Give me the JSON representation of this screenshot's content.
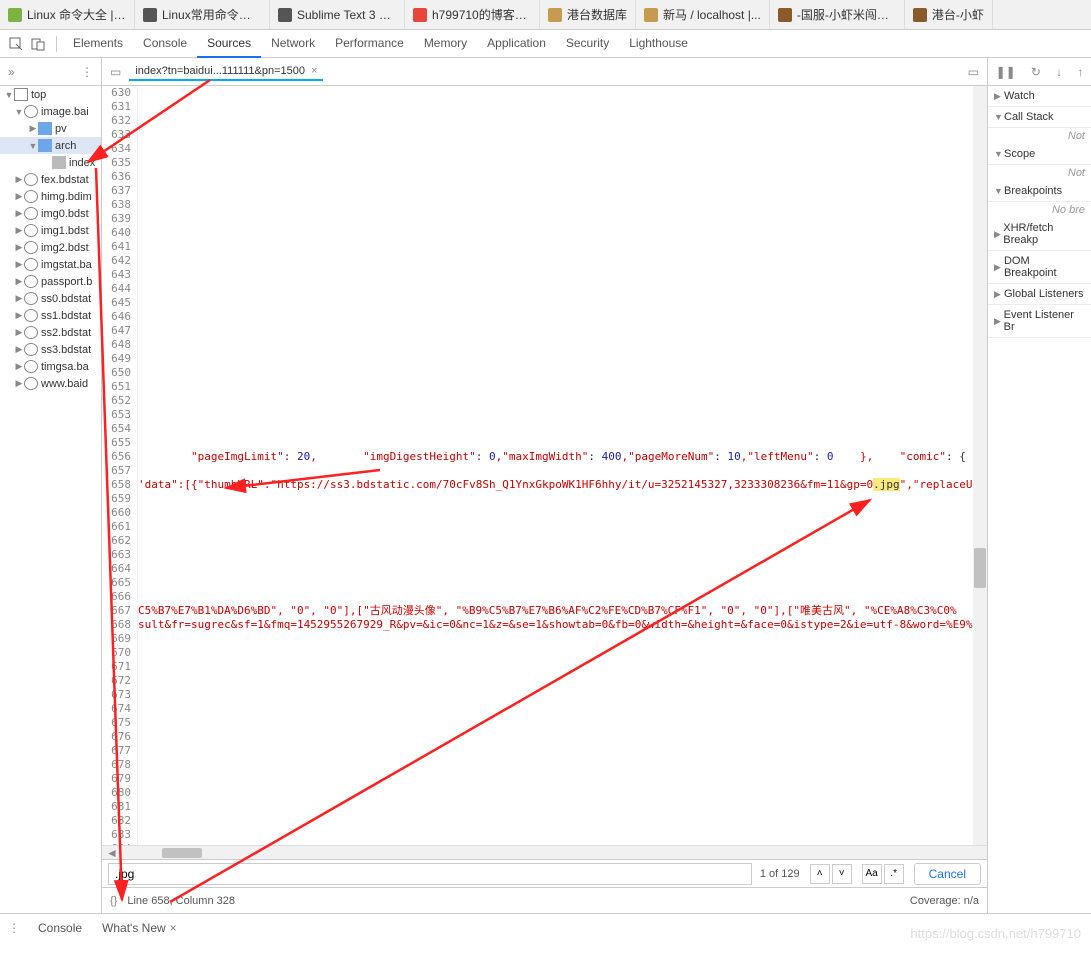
{
  "browserTabs": [
    {
      "label": "Linux 命令大全 | 菜...",
      "fav": "#7cb342"
    },
    {
      "label": "Linux常用命令大全...",
      "fav": "#555"
    },
    {
      "label": "Sublime Text 3 快...",
      "fav": "#555"
    },
    {
      "label": "h799710的博客_C...",
      "fav": "#e8453c"
    },
    {
      "label": "港台数据库",
      "fav": "#c69b4f"
    },
    {
      "label": "新马 / localhost |...",
      "fav": "#c69b4f"
    },
    {
      "label": "-国服-小虾米闯江湖",
      "fav": "#8a5a2a"
    },
    {
      "label": "港台-小虾",
      "fav": "#8a5a2a"
    }
  ],
  "devtoolsTabs": [
    "Elements",
    "Console",
    "Sources",
    "Network",
    "Performance",
    "Memory",
    "Application",
    "Security",
    "Lighthouse"
  ],
  "activeDevtoolsTab": "Sources",
  "openFileTab": "index?tn=baidui...111111&pn=1500",
  "tree": [
    {
      "ind": 1,
      "tw": "▼",
      "icon": "window",
      "label": "top"
    },
    {
      "ind": 2,
      "tw": "▼",
      "icon": "cloud",
      "label": "image.bai"
    },
    {
      "ind": 3,
      "tw": "▶",
      "icon": "folder",
      "label": "pv"
    },
    {
      "ind": 3,
      "tw": "▼",
      "icon": "folder",
      "label": "arch",
      "selected": true
    },
    {
      "ind": 4,
      "tw": "",
      "icon": "file",
      "label": "index"
    },
    {
      "ind": 2,
      "tw": "▶",
      "icon": "cloud",
      "label": "fex.bdstat"
    },
    {
      "ind": 2,
      "tw": "▶",
      "icon": "cloud",
      "label": "himg.bdim"
    },
    {
      "ind": 2,
      "tw": "▶",
      "icon": "cloud",
      "label": "img0.bdst"
    },
    {
      "ind": 2,
      "tw": "▶",
      "icon": "cloud",
      "label": "img1.bdst"
    },
    {
      "ind": 2,
      "tw": "▶",
      "icon": "cloud",
      "label": "img2.bdst"
    },
    {
      "ind": 2,
      "tw": "▶",
      "icon": "cloud",
      "label": "imgstat.ba"
    },
    {
      "ind": 2,
      "tw": "▶",
      "icon": "cloud",
      "label": "passport.b"
    },
    {
      "ind": 2,
      "tw": "▶",
      "icon": "cloud",
      "label": "ss0.bdstat"
    },
    {
      "ind": 2,
      "tw": "▶",
      "icon": "cloud",
      "label": "ss1.bdstat"
    },
    {
      "ind": 2,
      "tw": "▶",
      "icon": "cloud",
      "label": "ss2.bdstat"
    },
    {
      "ind": 2,
      "tw": "▶",
      "icon": "cloud",
      "label": "ss3.bdstat"
    },
    {
      "ind": 2,
      "tw": "▶",
      "icon": "cloud",
      "label": "timgsa.ba"
    },
    {
      "ind": 2,
      "tw": "▶",
      "icon": "cloud",
      "label": "www.baid"
    }
  ],
  "lineStart": 630,
  "lineEnd": 685,
  "code656": {
    "a": "        \"pageImgLimit\"",
    "b": ": ",
    "c": "20",
    "d": ",       \"imgDigestHeight\"",
    "e": ": ",
    "f": "0",
    "g": ",\"maxImgWidth\"",
    "h": ": ",
    "i": "400",
    "j": ",\"pageMoreNum\"",
    "k": ": ",
    "l": "10",
    "m": ",\"leftMenu\"",
    "n": ": ",
    "o": "0",
    "p": "    },    \"comic\"",
    "q": ": {"
  },
  "code658": {
    "a": "'data\":[{\"thumbURL\":\"https://ss3.bdstatic.com/70cFv8Sh_Q1YnxGkpoWK1HF6hhy/it/u=3252145327,3233308236&fm=11&gp=0",
    "hl": ".jpg",
    "b": "\",\"replaceU"
  },
  "code667": "C5%B7%E7%B1%DA%D6%BD\", \"0\", \"0\"],[\"古风动漫头像\", \"%B9%C5%B7%E7%B6%AF%C2%FE%CD%B7%CF%F1\", \"0\", \"0\"],[\"唯美古风\", \"%CE%A8%C3%C0%",
  "code668": "sult&fr=sugrec&sf=1&fmq=1452955267929_R&pv=&ic=0&nc=1&z=&se=1&showtab=0&fb=0&width=&height=&face=0&istype=2&ie=utf-8&word=%E9%",
  "search": {
    "value": ".jpg",
    "count": "1 of 129",
    "cancel": "Cancel"
  },
  "status": {
    "pos": "Line 658, Column 328",
    "coverage": "Coverage: n/a"
  },
  "rightPanel": {
    "sections": [
      {
        "tw": "▶",
        "label": "Watch"
      },
      {
        "tw": "▼",
        "label": "Call Stack"
      },
      {
        "italic": "Not"
      },
      {
        "tw": "▼",
        "label": "Scope"
      },
      {
        "italic": "Not"
      },
      {
        "tw": "▼",
        "label": "Breakpoints"
      },
      {
        "italic": "No bre"
      },
      {
        "tw": "▶",
        "label": "XHR/fetch Breakp"
      },
      {
        "tw": "▶",
        "label": "DOM Breakpoint"
      },
      {
        "tw": "▶",
        "label": "Global Listeners"
      },
      {
        "tw": "▶",
        "label": "Event Listener Br"
      }
    ]
  },
  "drawer": {
    "tab1": "Console",
    "tab2": "What's New"
  },
  "watermark": "https://blog.csdn.net/h799710"
}
